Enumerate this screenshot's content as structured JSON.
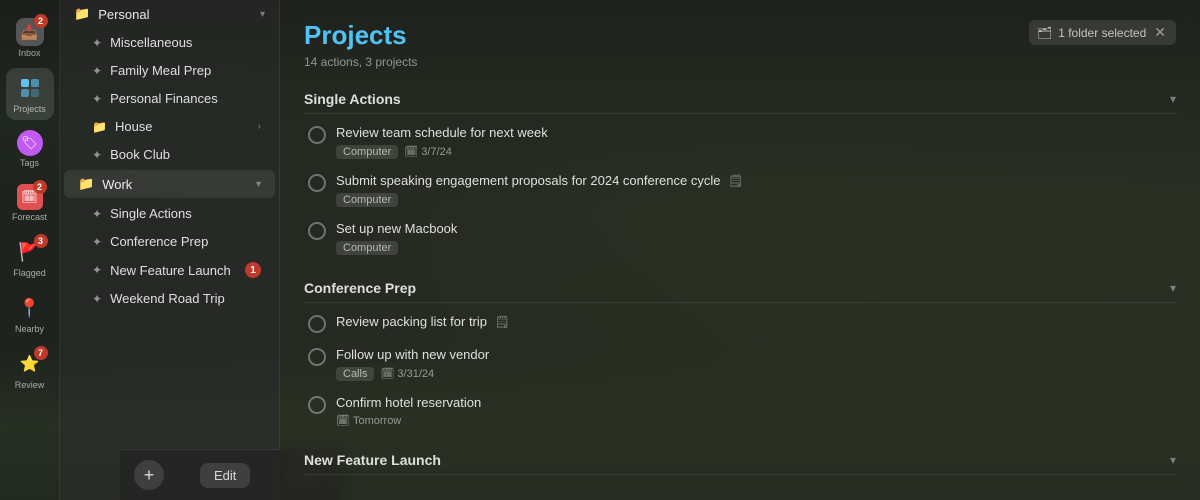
{
  "background": {
    "alt": "Forest landscape background"
  },
  "iconSidebar": {
    "items": [
      {
        "id": "inbox",
        "label": "Inbox",
        "icon": "📥",
        "badge": "2",
        "hasBadge": true
      },
      {
        "id": "projects",
        "label": "Projects",
        "icon": "⬛",
        "hasBadge": false
      },
      {
        "id": "tags",
        "label": "Tags",
        "icon": "🏷",
        "hasBadge": false
      },
      {
        "id": "forecast",
        "label": "Forecast",
        "icon": "🗓",
        "badge": "2",
        "hasBadge": true
      },
      {
        "id": "flagged",
        "label": "Flagged",
        "icon": "🚩",
        "badge": "3",
        "hasBadge": true
      },
      {
        "id": "nearby",
        "label": "Nearby",
        "icon": "📍",
        "hasBadge": false
      },
      {
        "id": "review",
        "label": "Review",
        "icon": "⭐",
        "badge": "7",
        "hasBadge": true
      }
    ]
  },
  "projectsPanel": {
    "groups": [
      {
        "id": "personal",
        "name": "Personal",
        "icon": "📁",
        "expanded": true,
        "items": [
          {
            "name": "Miscellaneous",
            "icon": "✦",
            "badge": null
          },
          {
            "name": "Family Meal Prep",
            "icon": "✦",
            "badge": null
          },
          {
            "name": "Personal Finances",
            "icon": "✦",
            "badge": null
          },
          {
            "name": "House",
            "icon": "📁",
            "isFolder": true,
            "badge": null
          },
          {
            "name": "Book Club",
            "icon": "✦",
            "badge": null
          }
        ]
      },
      {
        "id": "work",
        "name": "Work",
        "icon": "📁",
        "expanded": true,
        "items": [
          {
            "name": "Single Actions",
            "icon": "✦",
            "badge": null
          },
          {
            "name": "Conference Prep",
            "icon": "✦",
            "badge": null
          },
          {
            "name": "New Feature Launch",
            "icon": "✦",
            "badge": "1"
          },
          {
            "name": "Weekend Road Trip",
            "icon": "✦",
            "badge": null
          }
        ]
      }
    ],
    "addButton": "+",
    "editButton": "Edit",
    "listButton": "☰"
  },
  "mainContent": {
    "title": "Projects",
    "meta": "14 actions, 3 projects",
    "folderSelected": "1 folder selected",
    "sections": [
      {
        "id": "single-actions",
        "title": "Single Actions",
        "tasks": [
          {
            "name": "Review team schedule for next week",
            "tags": [
              "Computer"
            ],
            "date": "3/7/24",
            "hasNote": true
          },
          {
            "name": "Submit speaking engagement proposals for 2024 conference cycle",
            "tags": [
              "Computer"
            ],
            "date": null,
            "hasNote": true
          },
          {
            "name": "Set up new Macbook",
            "tags": [
              "Computer"
            ],
            "date": null,
            "hasNote": false
          }
        ]
      },
      {
        "id": "conference-prep",
        "title": "Conference Prep",
        "tasks": [
          {
            "name": "Review packing list for trip",
            "tags": [],
            "date": null,
            "hasNote": true
          },
          {
            "name": "Follow up with new vendor",
            "tags": [
              "Calls"
            ],
            "date": "3/31/24",
            "hasNote": false
          },
          {
            "name": "Confirm hotel reservation",
            "tags": [],
            "date": "Tomorrow",
            "hasNote": false,
            "dateIcon": "🗓"
          }
        ]
      },
      {
        "id": "new-feature-launch",
        "title": "New Feature Launch",
        "tasks": []
      }
    ]
  }
}
